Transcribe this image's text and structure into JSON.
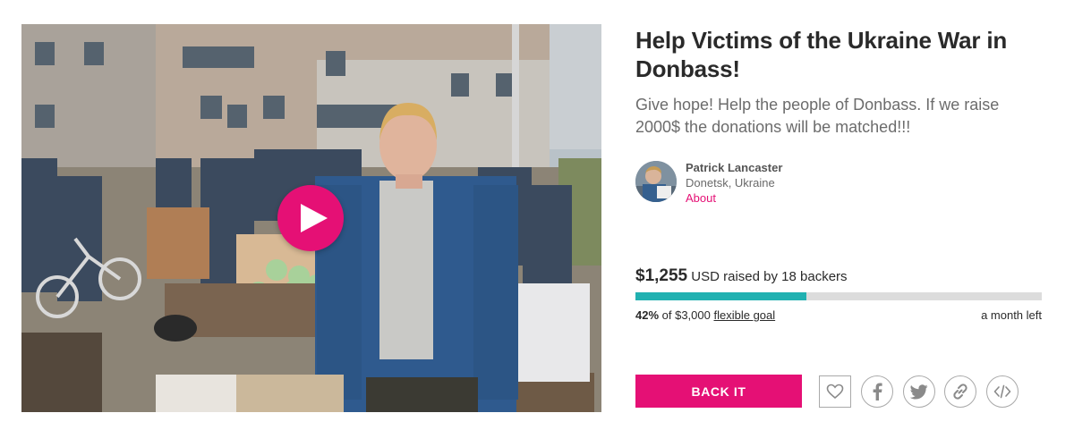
{
  "media": {
    "play_icon": "play-icon"
  },
  "campaign": {
    "title": "Help Victims of the Ukraine War in Donbass!",
    "tagline": "Give hope! Help the people of Donbass. If we raise 2000$ the donations will be matched!!!"
  },
  "owner": {
    "name": "Patrick Lancaster",
    "location": "Donetsk, Ukraine",
    "about_label": "About"
  },
  "funding": {
    "amount": "$1,255",
    "raised_text": " USD raised by 18 backers",
    "progress_fraction": 0.42,
    "percent": "42%",
    "of_text": " of $3,000 ",
    "goal_link": "flexible goal",
    "time_left": "a month left"
  },
  "actions": {
    "back_label": "BACK IT",
    "follow_icon": "heart-icon",
    "share_icons": [
      "facebook-icon",
      "twitter-icon",
      "link-icon",
      "embed-icon"
    ]
  },
  "colors": {
    "accent": "#e51075",
    "progress": "#21b1b1",
    "track": "#dcdcdc"
  }
}
